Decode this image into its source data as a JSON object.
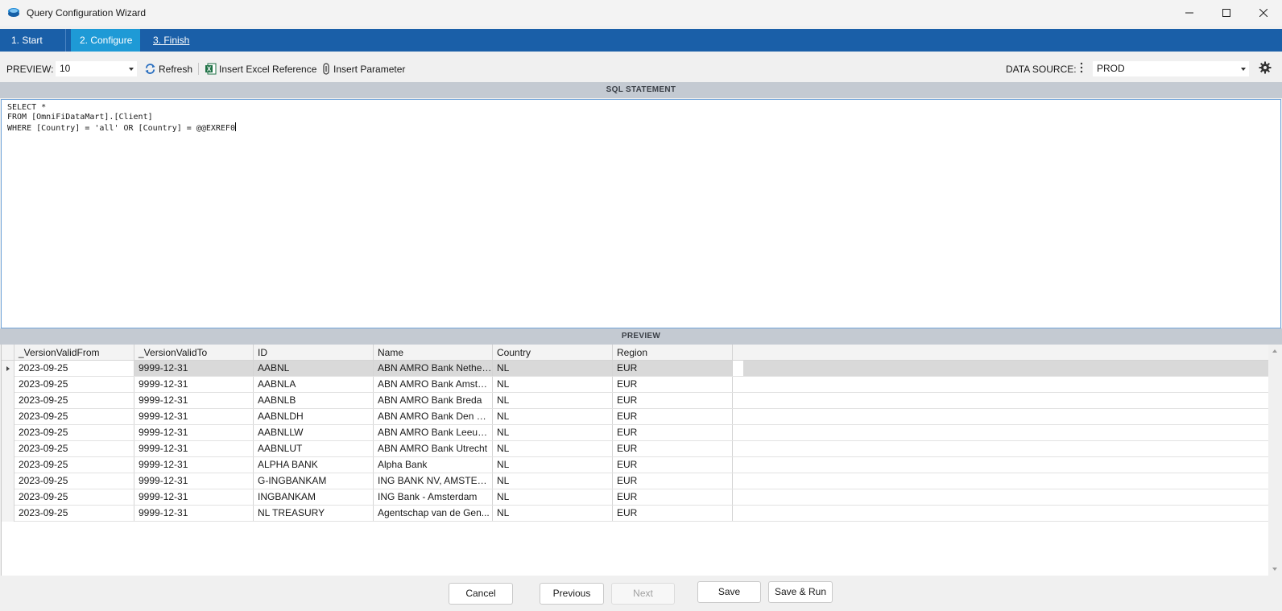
{
  "window": {
    "title": "Query Configuration Wizard",
    "icon": "cloud-database-icon"
  },
  "steps": [
    {
      "label": "1. Start"
    },
    {
      "label": "2. Configure",
      "active": true
    },
    {
      "label": "3. Finish"
    }
  ],
  "toolbar": {
    "preview_label": "PREVIEW:",
    "preview_value": "10",
    "refresh_label": "Refresh",
    "insert_excel_label": "Insert Excel Reference",
    "insert_parameter_label": "Insert Parameter",
    "datasource_label": "DATA SOURCE:",
    "datasource_value": "PROD"
  },
  "sql": {
    "header": "SQL STATEMENT",
    "lines": [
      "SELECT *",
      "FROM [OmniFiDataMart].[Client]",
      "WHERE [Country] = 'all' OR [Country] = @@EXREF0"
    ]
  },
  "preview": {
    "header": "PREVIEW",
    "columns": [
      "_VersionValidFrom",
      "_VersionValidTo",
      "ID",
      "Name",
      "Country",
      "Region"
    ],
    "rows": [
      [
        "2023-09-25",
        "9999-12-31",
        "AABNL",
        "ABN AMRO Bank Netherl...",
        "NL",
        "EUR"
      ],
      [
        "2023-09-25",
        "9999-12-31",
        "AABNLA",
        "ABN AMRO Bank Amster...",
        "NL",
        "EUR"
      ],
      [
        "2023-09-25",
        "9999-12-31",
        "AABNLB",
        "ABN AMRO Bank Breda",
        "NL",
        "EUR"
      ],
      [
        "2023-09-25",
        "9999-12-31",
        "AABNLDH",
        "ABN AMRO Bank Den Ha...",
        "NL",
        "EUR"
      ],
      [
        "2023-09-25",
        "9999-12-31",
        "AABNLLW",
        "ABN AMRO Bank Leeuw...",
        "NL",
        "EUR"
      ],
      [
        "2023-09-25",
        "9999-12-31",
        "AABNLUT",
        "ABN AMRO Bank Utrecht",
        "NL",
        "EUR"
      ],
      [
        "2023-09-25",
        "9999-12-31",
        "ALPHA BANK",
        "Alpha Bank",
        "NL",
        "EUR"
      ],
      [
        "2023-09-25",
        "9999-12-31",
        "G-INGBANKAM",
        "ING BANK NV, AMSTERD...",
        "NL",
        "EUR"
      ],
      [
        "2023-09-25",
        "9999-12-31",
        "INGBANKAM",
        "ING Bank - Amsterdam",
        "NL",
        "EUR"
      ],
      [
        "2023-09-25",
        "9999-12-31",
        "NL TREASURY",
        "Agentschap van de Gen...",
        "NL",
        "EUR"
      ]
    ],
    "selected_row": 0
  },
  "footer": {
    "cancel_label": "Cancel",
    "previous_label": "Previous",
    "next_label": "Next",
    "save_label": "Save",
    "save_run_label": "Save & Run"
  },
  "colors": {
    "steps_bar": "#1a5fa8",
    "active_step": "#1e9ad6",
    "section_header": "#c4cad2",
    "selected_row": "#d9d9d9"
  }
}
